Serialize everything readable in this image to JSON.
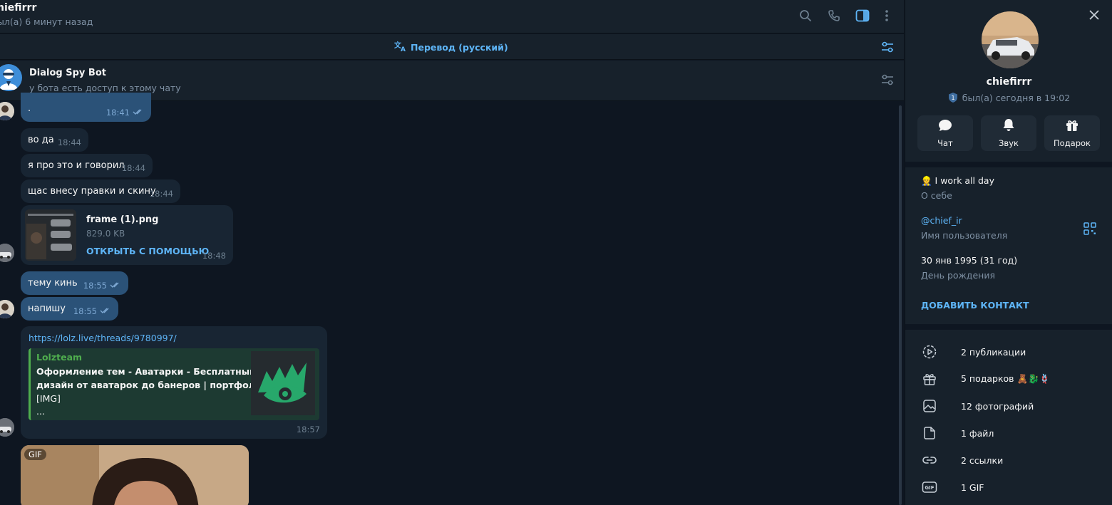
{
  "header": {
    "name": "hiefirrr",
    "status": "ыл(а) 6 минут назад"
  },
  "translate": {
    "label": "Перевод (русский)"
  },
  "bot": {
    "name": "Dialog Spy Bot",
    "subtitle": "у бота есть доступ к этому чату"
  },
  "messages": [
    {
      "text": "·",
      "time": "18:41",
      "dir": "out"
    },
    {
      "text": "во да",
      "time": "18:44",
      "dir": "in"
    },
    {
      "text": "я про это и говорил",
      "time": "18:44",
      "dir": "in"
    },
    {
      "text": "щас внесу правки и скину",
      "time": "18:44",
      "dir": "in"
    },
    {
      "file_name": "frame (1).png",
      "file_size": "829.0 KB",
      "open_with": "ОТКРЫТЬ С ПОМОЩЬЮ",
      "time": "18:48",
      "dir": "in"
    },
    {
      "text": "тему кинь",
      "time": "18:55",
      "dir": "out"
    },
    {
      "text": "напишу",
      "time": "18:55",
      "dir": "out"
    },
    {
      "link": "https://lolz.live/threads/9780997/",
      "preview_site": "Lolzteam",
      "preview_title_1": "Оформление тем - Аватарки - Бесплатный",
      "preview_title_2": "дизайн от аватарок до банеров | портфол...",
      "preview_img": "[IMG]",
      "preview_more": "...",
      "time": "18:57",
      "dir": "in"
    },
    {
      "badge": "GIF",
      "dir": "in"
    }
  ],
  "profile": {
    "name": "chiefirrr",
    "status": "был(а) сегодня в 19:02",
    "actions": [
      {
        "label": "Чат",
        "icon": "chat-icon"
      },
      {
        "label": "Звук",
        "icon": "bell-icon"
      },
      {
        "label": "Подарок",
        "icon": "gift-icon"
      }
    ],
    "bio": "👷 I work all day",
    "bio_label": "О себе",
    "username": "@chief_ir",
    "username_label": "Имя пользователя",
    "birthday": "30 янв 1995 (31 год)",
    "birthday_label": "День рождения",
    "add_contact": "ДОБАВИТЬ КОНТАКТ",
    "media": [
      {
        "label": "2 публикации",
        "icon": "stories-icon"
      },
      {
        "label": "5 подарков 🧸🐉🪢",
        "icon": "gift-icon"
      },
      {
        "label": "12 фотографий",
        "icon": "photo-icon"
      },
      {
        "label": "1 файл",
        "icon": "file-icon"
      },
      {
        "label": "2 ссылки",
        "icon": "link-icon"
      },
      {
        "label": "1 GIF",
        "icon": "gif-icon"
      }
    ]
  },
  "colors": {
    "background": "#0e1621",
    "panel": "#17212b",
    "bubble_in": "#182533",
    "bubble_out": "#2b5278",
    "accent": "#5eb5f7",
    "muted": "#7f91a4"
  }
}
